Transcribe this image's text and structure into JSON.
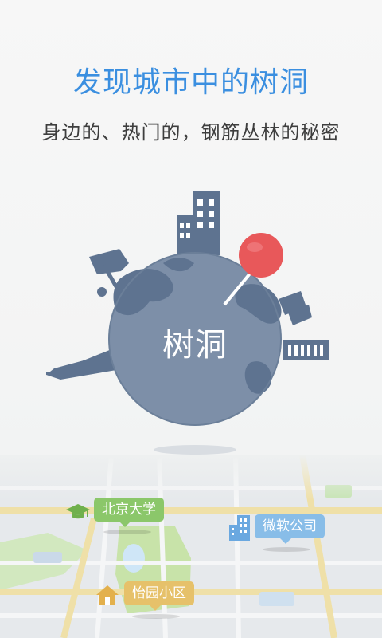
{
  "headline": "发现城市中的树洞",
  "tagline": "身边的、热门的，钢筋丛林的秘密",
  "globe_text": "树洞",
  "map_pins": [
    {
      "label": "北京大学",
      "icon": "graduation-cap-icon"
    },
    {
      "label": "微软公司",
      "icon": "building-icon"
    },
    {
      "label": "怡园小区",
      "icon": "house-icon"
    }
  ],
  "colors": {
    "accent": "#3b8fe0",
    "globe": "#7d8fa8",
    "pin_red": "#e8585a",
    "tag_green": "#8bc76a",
    "tag_blue": "#88bde8",
    "tag_yellow": "#e6c16a"
  }
}
